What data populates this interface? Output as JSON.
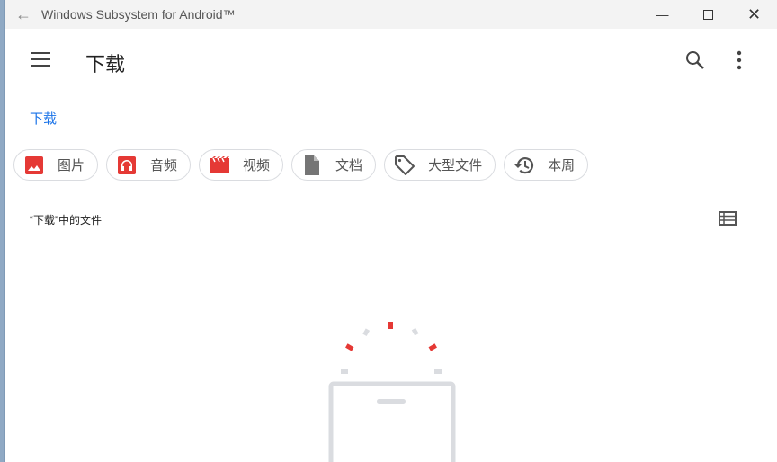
{
  "window": {
    "title": "Windows Subsystem for Android™"
  },
  "appbar": {
    "title": "下载"
  },
  "breadcrumb": "下载",
  "chips": [
    {
      "label": "图片",
      "icon": "image-icon",
      "color": "#e53935"
    },
    {
      "label": "音频",
      "icon": "headphones-icon",
      "color": "#e53935"
    },
    {
      "label": "视频",
      "icon": "movie-icon",
      "color": "#e53935"
    },
    {
      "label": "文档",
      "icon": "document-icon",
      "color": "#757575"
    },
    {
      "label": "大型文件",
      "icon": "tag-icon",
      "color": "#555555"
    },
    {
      "label": "本周",
      "icon": "history-icon",
      "color": "#555555"
    }
  ],
  "section": {
    "title": "“下载”中的文件"
  }
}
